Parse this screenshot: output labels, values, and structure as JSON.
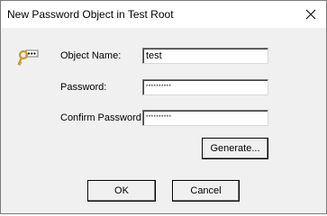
{
  "window": {
    "title": "New Password Object in Test Root",
    "close_glyph": "✕"
  },
  "form": {
    "object_name_label": "Object Name:",
    "object_name_value": "test",
    "password_label": "Password:",
    "password_value": "**********",
    "confirm_password_label": "Confirm Password:",
    "confirm_password_value": "**********"
  },
  "buttons": {
    "generate": "Generate...",
    "ok": "OK",
    "cancel": "Cancel"
  },
  "icons": {
    "object": "key-password-icon",
    "close": "close-icon"
  },
  "colors": {
    "dialog_bg": "#f0f0f0",
    "titlebar_bg": "#ffffff",
    "key_gold": "#c89b2a"
  }
}
